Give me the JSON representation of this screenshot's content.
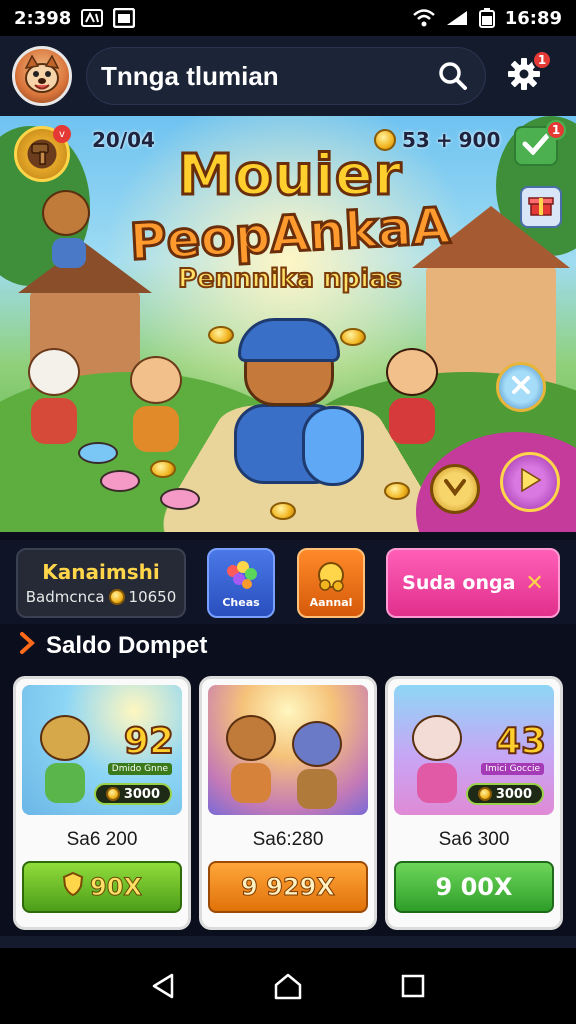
{
  "status_bar": {
    "time": "2:398",
    "clock": "16:89"
  },
  "header": {
    "title": "Tnnga tlumian",
    "notification_count": "1"
  },
  "banner": {
    "score": "20/04",
    "coins": "53",
    "gems": "900",
    "title_line1": "Mouier",
    "title_line2": "PeopAnkaA",
    "title_line3": "Pennnika npias",
    "check_badge": "1",
    "level_badge": "v"
  },
  "actions": {
    "main_title": "Kanaimshi",
    "main_subtitle": "Badmcnca",
    "main_amount": "10650",
    "blue_label": "Cheas",
    "orange_label": "Aannal",
    "pink_label": "Suda onga",
    "pink_icon": "✕"
  },
  "section": {
    "title": "Saldo Dompet"
  },
  "cards": [
    {
      "big_text": "92",
      "ribbon": "Dmido Gnne",
      "pill": "3000",
      "label": "Sa6 200",
      "button": "90X",
      "button_color": "#4c9e1a"
    },
    {
      "big_text": "",
      "ribbon": "",
      "pill": "",
      "label": "Sa6:280",
      "button": "9 929X",
      "button_color": "#e0720a"
    },
    {
      "big_text": "43",
      "ribbon": "Imici Goccie",
      "pill": "3000",
      "label": "Sa6 300",
      "button": "9 00X",
      "button_color": "#2e9e2a"
    }
  ],
  "icons": {
    "status_left": [
      "sim-icon",
      "window-icon"
    ],
    "status_right": [
      "wifi-icon",
      "signal-icon",
      "battery-icon"
    ],
    "header": [
      "avatar",
      "search-icon",
      "gear-icon"
    ],
    "nav": [
      "back-icon",
      "home-icon",
      "recents-icon"
    ]
  },
  "colors": {
    "background": "#0b0f1d",
    "header": "#141b2d",
    "accent_orange": "#ff6a1a",
    "badge_red": "#e53935",
    "gold": "#ffd54a",
    "pink": "#e0308c"
  }
}
